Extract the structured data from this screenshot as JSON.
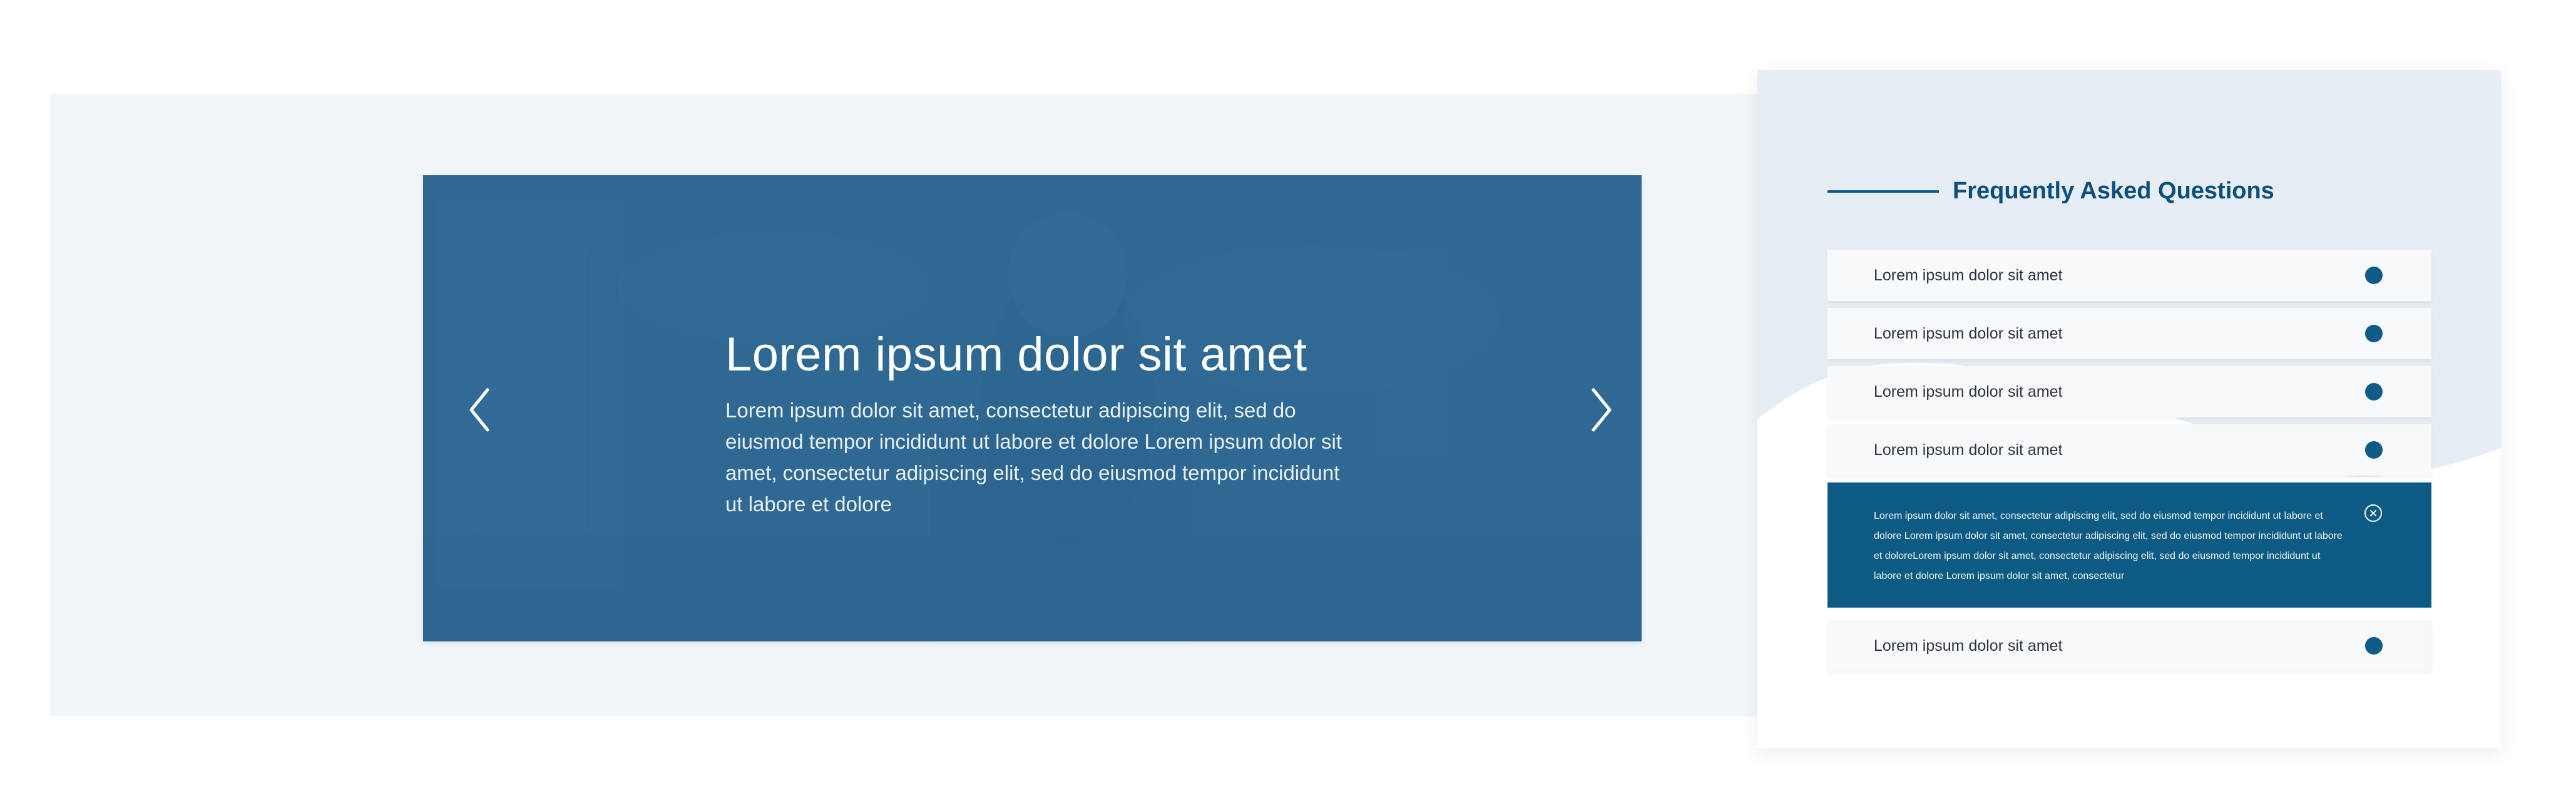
{
  "hero": {
    "title": "Lorem ipsum dolor sit amet",
    "text": "Lorem ipsum dolor sit amet, consectetur adipiscing elit, sed do eiusmod tempor incididunt ut labore et dolore Lorem ipsum dolor sit amet, consectetur adipiscing elit, sed do eiusmod tempor incididunt ut labore et dolore",
    "prev_icon": "chevron-left-icon",
    "next_icon": "chevron-right-icon"
  },
  "faq": {
    "title": "Frequently Asked Questions",
    "items": [
      {
        "label": "Lorem ipsum dolor sit amet"
      },
      {
        "label": "Lorem ipsum dolor sit amet"
      },
      {
        "label": "Lorem ipsum dolor sit amet"
      },
      {
        "label": "Lorem ipsum dolor sit amet"
      }
    ],
    "open_item": {
      "text": "Lorem ipsum dolor sit amet, consectetur adipiscing elit, sed do eiusmod tempor incididunt ut labore et dolore Lorem ipsum dolor sit amet, consectetur adipiscing elit, sed do eiusmod tempor incididunt ut labore et doloreLorem ipsum dolor sit amet, consectetur adipiscing elit, sed do eiusmod tempor incididunt ut labore et dolore Lorem ipsum dolor sit amet, consectetur",
      "close_icon": "close-circle-icon"
    },
    "last_item": {
      "label": "Lorem ipsum dolor sit amet"
    }
  },
  "colors": {
    "accent": "#0e5c8b",
    "slider_overlay": "#2b6592",
    "section_background": "#f3f6f9"
  }
}
